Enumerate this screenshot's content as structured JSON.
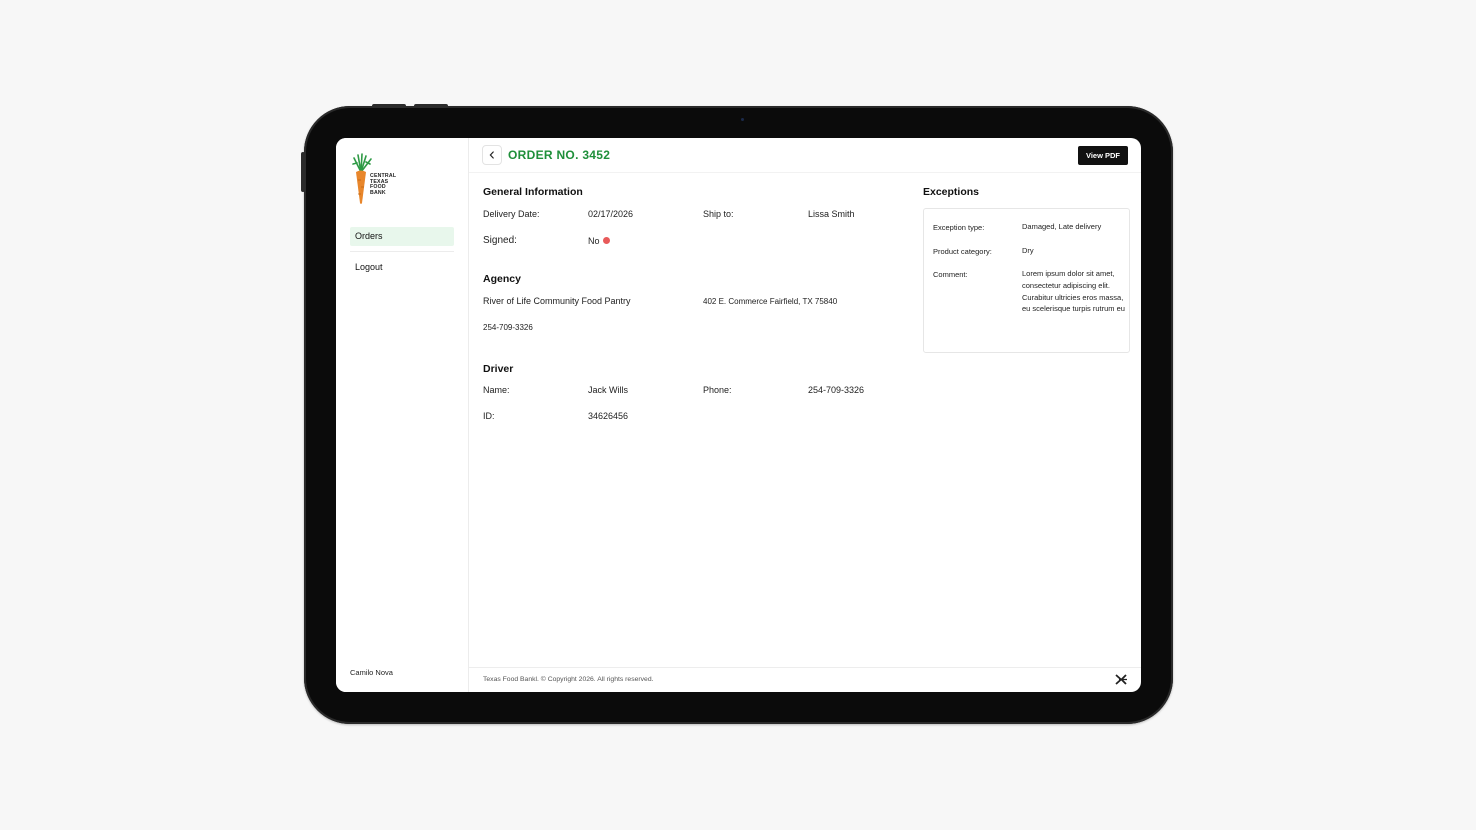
{
  "sidebar": {
    "logo_text": [
      "CENTRAL",
      "TEXAS",
      "FOOD",
      "BANK"
    ],
    "items": [
      {
        "label": "Orders",
        "active": true
      },
      {
        "label": "Logout",
        "active": false
      }
    ],
    "user_name": "Camilo Nova"
  },
  "header": {
    "title": "ORDER NO. 3452",
    "view_pdf_label": "View PDF"
  },
  "general": {
    "title": "General Information",
    "delivery_date_label": "Delivery Date:",
    "delivery_date": "02/17/2026",
    "ship_to_label": "Ship to:",
    "ship_to": "Lissa Smith",
    "signed_label": "Signed:",
    "signed": "No"
  },
  "agency": {
    "title": "Agency",
    "name": "River of Life Community Food Pantry",
    "address": "402 E. Commerce Fairfield, TX 75840",
    "phone": "254-709-3326"
  },
  "driver": {
    "title": "Driver",
    "name_label": "Name:",
    "name": "Jack Wills",
    "phone_label": "Phone:",
    "phone": "254-709-3326",
    "id_label": "ID:",
    "id": "34626456"
  },
  "exceptions": {
    "title": "Exceptions",
    "type_label": "Exception type:",
    "type": "Damaged, Late delivery",
    "category_label": "Product category:",
    "category": "Dry",
    "comment_label": "Comment:",
    "comment": "Lorem ipsum dolor sit amet, consectetur adipiscing elit. Curabitur ultricies eros massa, eu scelerisque turpis rutrum eu"
  },
  "footer": {
    "copyright": "Texas Food Bankl. © Copyright 2026. All rights reserved."
  },
  "colors": {
    "accent_green": "#1f8f3a",
    "active_nav_bg": "#e8f7ec",
    "status_red": "#e85a5a",
    "carrot_orange": "#e8862b"
  }
}
